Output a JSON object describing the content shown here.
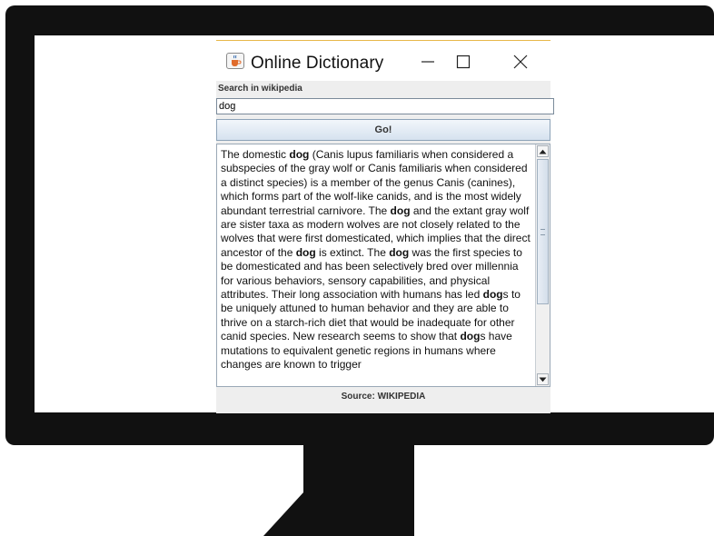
{
  "window": {
    "title": "Online Dictionary"
  },
  "search": {
    "label": "Search in wikipedia",
    "value": "dog",
    "button_label": "Go!"
  },
  "result": {
    "segments": [
      {
        "t": "The domestic ",
        "b": false
      },
      {
        "t": "dog",
        "b": true
      },
      {
        "t": " (Canis lupus familiaris when considered a subspecies of the gray wolf or Canis familiaris when considered a distinct species) is a member of the genus Canis (canines), which forms part of the wolf-like canids, and is the most widely abundant terrestrial carnivore. The ",
        "b": false
      },
      {
        "t": "dog",
        "b": true
      },
      {
        "t": " and the extant gray wolf are sister taxa as modern wolves are not closely related to the wolves that were first domesticated, which implies that the direct ancestor of the ",
        "b": false
      },
      {
        "t": "dog",
        "b": true
      },
      {
        "t": " is extinct. The ",
        "b": false
      },
      {
        "t": "dog",
        "b": true
      },
      {
        "t": " was the first species to be domesticated and has been selectively bred over millennia for various behaviors, sensory capabilities, and physical attributes. Their long association with humans has led ",
        "b": false
      },
      {
        "t": "dog",
        "b": true
      },
      {
        "t": "s to be uniquely attuned to human behavior and they are able to thrive on a starch-rich diet that would be inadequate for other canid species. New research seems to show that ",
        "b": false
      },
      {
        "t": "dog",
        "b": true
      },
      {
        "t": "s have mutations to equivalent genetic regions in humans where changes are known to trigger",
        "b": false
      }
    ]
  },
  "footer": {
    "source": "Source: WIKIPEDIA"
  },
  "icons": {
    "app": "java-cup-icon",
    "minimize": "minimize-icon",
    "maximize": "maximize-icon",
    "close": "close-icon",
    "scroll_up": "scroll-up-arrow-icon",
    "scroll_down": "scroll-down-arrow-icon"
  }
}
